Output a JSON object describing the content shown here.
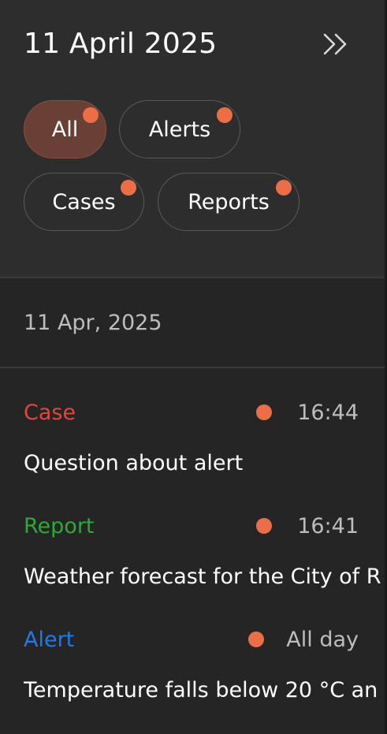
{
  "header": {
    "title": "11 April 2025",
    "collapse_icon": "double-chevron-right-icon"
  },
  "filters": [
    {
      "label": "All",
      "active": true
    },
    {
      "label": "Alerts",
      "active": false
    },
    {
      "label": "Cases",
      "active": false
    },
    {
      "label": "Reports",
      "active": false
    }
  ],
  "group": {
    "date": "11 Apr, 2025"
  },
  "items": [
    {
      "type": "Case",
      "time": "16:44",
      "description": "Question about alert"
    },
    {
      "type": "Report",
      "time": "16:41",
      "description": "Weather forecast for the City of R"
    },
    {
      "type": "Alert",
      "time": "All day",
      "description": "Temperature falls below 20 °C an"
    }
  ],
  "colors": {
    "background": "#252525",
    "header_background": "#2d2d2d",
    "accent_dot": "#eb6e47",
    "active_chip": "#6a3f35",
    "case": "#e5443c",
    "report": "#2ea836",
    "alert": "#1f7ae8",
    "muted_text": "#bdbdbd"
  }
}
